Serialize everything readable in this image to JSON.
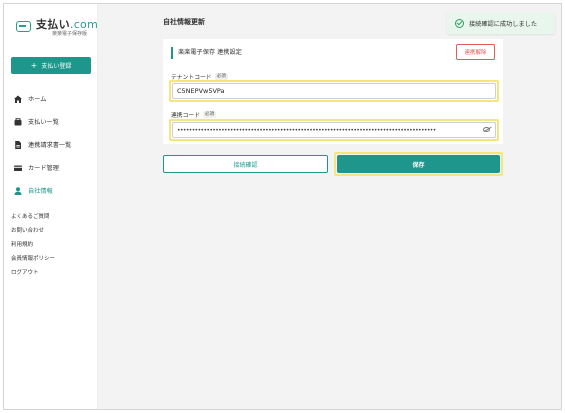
{
  "app": {
    "logo_text": "支払い",
    "logo_dot": ".com",
    "logo_sub": "楽楽電子保存版"
  },
  "sidebar": {
    "register_label": "支払い登録",
    "items": [
      {
        "label": "ホーム",
        "icon": "home-icon"
      },
      {
        "label": "支払い一覧",
        "icon": "payment-list-icon"
      },
      {
        "label": "連携請求書一覧",
        "icon": "document-icon"
      },
      {
        "label": "カード管理",
        "icon": "card-icon"
      },
      {
        "label": "自社情報",
        "icon": "user-icon",
        "active": true
      }
    ],
    "links": [
      "よくあるご質問",
      "お問い合わせ",
      "利用規約",
      "会員情報ポリシー",
      "ログアウト"
    ]
  },
  "main": {
    "page_title": "自社情報更新",
    "toast": "接続確認に成功しました",
    "section_title": "楽楽電子保存 連携設定",
    "unlink_label": "連携解除",
    "tenant": {
      "label": "テナントコード",
      "required": "必須",
      "value": "C5NEPVw5VPa"
    },
    "link_code": {
      "label": "連携コード",
      "required": "必須",
      "value": "••••••••••••••••••••••••••••••••••••••••••••••••••••••••••••••••••••••••••••••••••••••••"
    },
    "connect_label": "接続確認",
    "save_label": "保存"
  },
  "colors": {
    "accent": "#1f968c",
    "danger": "#e15b5b",
    "highlight": "#f4e67a",
    "toast_bg": "#e9f6ee"
  }
}
